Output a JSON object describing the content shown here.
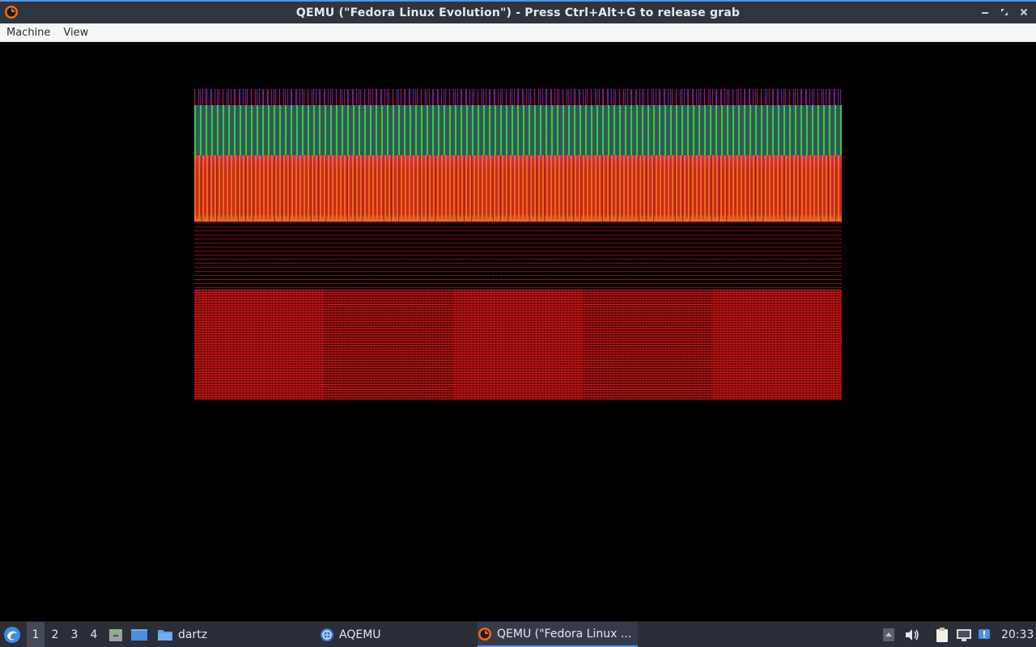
{
  "window": {
    "title": "QEMU (\"Fedora Linux Evolution\") - Press Ctrl+Alt+G to release grab",
    "app_icon": "qemu-logo-icon",
    "buttons": [
      "minimize-icon",
      "maximize-icon",
      "close-icon"
    ]
  },
  "menubar": {
    "items": [
      {
        "label": "Machine"
      },
      {
        "label": "View"
      }
    ]
  },
  "vm_display": {
    "description_state": "garbled framebuffer"
  },
  "taskbar": {
    "start_icon": "start-menu-icon",
    "workspaces": [
      {
        "label": "1",
        "active": true
      },
      {
        "label": "2",
        "active": false
      },
      {
        "label": "3",
        "active": false
      },
      {
        "label": "4",
        "active": false
      }
    ],
    "launchers": [
      {
        "icon": "file-manager-icon"
      },
      {
        "icon": "show-desktop-icon"
      },
      {
        "icon": "folder-icon",
        "label": "dartz"
      }
    ],
    "tasks": [
      {
        "icon": "aqemu-icon",
        "label": "AQEMU",
        "active": false
      },
      {
        "icon": "qemu-logo-icon",
        "label": "QEMU (\"Fedora Linux ...",
        "active": true
      }
    ],
    "tray": [
      "expand-up-icon",
      "volume-icon",
      "clipboard-icon",
      "network-icon",
      "update-notifier-icon"
    ],
    "clock": "20:33",
    "accent_color": "#5294e2"
  }
}
